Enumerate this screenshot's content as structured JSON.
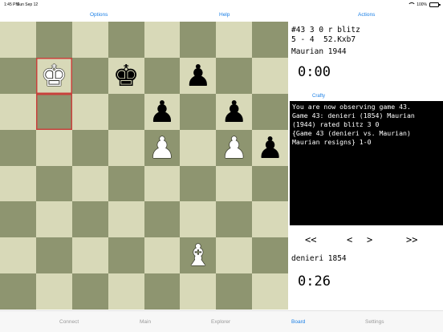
{
  "status_bar": {
    "time": "1:45 PM",
    "date": "Sun Sep 12",
    "battery": "100%"
  },
  "menu": {
    "options": "Options",
    "help": "Help",
    "actions": "Actions"
  },
  "board": {
    "colors": {
      "light": "#d8d9b8",
      "dark": "#8e9570",
      "highlight": "#c8413b"
    },
    "highlights": [
      "b7",
      "b6"
    ],
    "pieces": [
      {
        "square": "b7",
        "color": "white",
        "type": "king",
        "glyph": "♚"
      },
      {
        "square": "d7",
        "color": "black",
        "type": "king",
        "glyph": "♚"
      },
      {
        "square": "f7",
        "color": "black",
        "type": "pawn",
        "glyph": "♟"
      },
      {
        "square": "e6",
        "color": "black",
        "type": "pawn",
        "glyph": "♟"
      },
      {
        "square": "g6",
        "color": "black",
        "type": "pawn",
        "glyph": "♟"
      },
      {
        "square": "e5",
        "color": "white",
        "type": "pawn",
        "glyph": "♟"
      },
      {
        "square": "g5",
        "color": "white",
        "type": "pawn",
        "glyph": "♟"
      },
      {
        "square": "h5",
        "color": "black",
        "type": "pawn",
        "glyph": "♟"
      },
      {
        "square": "f2",
        "color": "white",
        "type": "bishop",
        "glyph": "♝"
      }
    ]
  },
  "game": {
    "header_line1": "#43 3 0 r blitz",
    "header_line2": "5 - 4  52.Kxb7",
    "top_player": "Maurian 1944",
    "top_clock": "0:00",
    "engine_label": "Crafty",
    "console_lines": [
      "You are now observing game 43.",
      "Game 43: denieri (1854) Maurian",
      "(1944) rated blitz 3 0",
      "{Game 43 (denieri vs. Maurian)",
      "Maurian resigns} 1-0"
    ],
    "bottom_player": "denieri 1854",
    "bottom_clock": "0:26"
  },
  "nav": {
    "first": "<<",
    "prev": "<",
    "next": ">",
    "last": ">>"
  },
  "tabs": {
    "connect": "Connect",
    "main": "Main",
    "explorer": "Explorer",
    "board": "Board",
    "settings": "Settings"
  }
}
